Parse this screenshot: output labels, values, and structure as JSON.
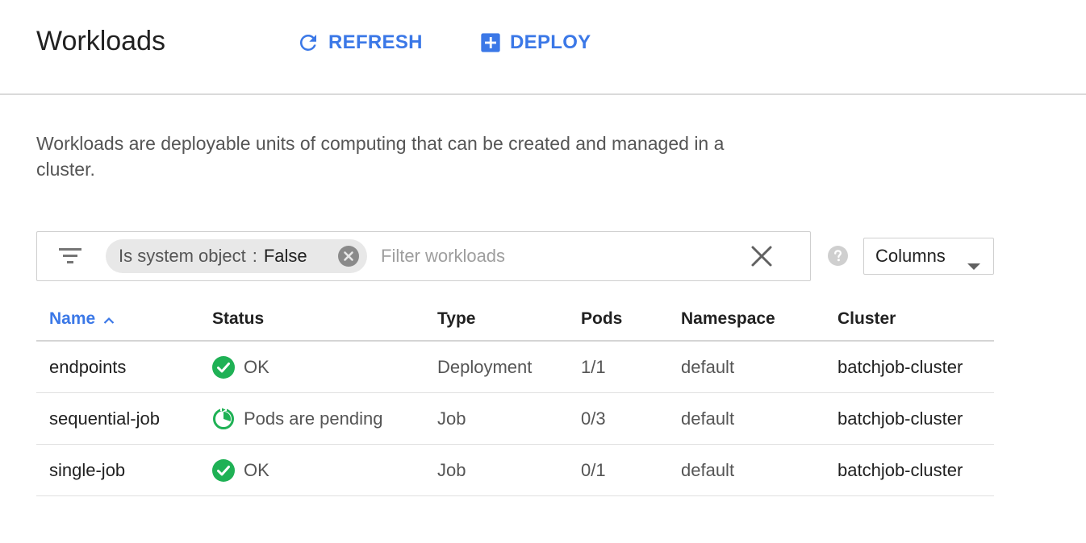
{
  "header": {
    "title": "Workloads",
    "refresh_label": "REFRESH",
    "deploy_label": "DEPLOY"
  },
  "description": "Workloads are deployable units of computing that can be created and managed in a cluster.",
  "filter": {
    "chip_key": "Is system object",
    "chip_sep": ":",
    "chip_value": "False",
    "placeholder": "Filter workloads"
  },
  "columns_button": "Columns",
  "table": {
    "headers": {
      "name": "Name",
      "status": "Status",
      "type": "Type",
      "pods": "Pods",
      "namespace": "Namespace",
      "cluster": "Cluster"
    },
    "sort": {
      "column": "name",
      "direction": "ascending"
    },
    "rows": [
      {
        "name": "endpoints",
        "status": "OK",
        "status_icon": "check-circle-icon",
        "type": "Deployment",
        "pods": "1/1",
        "namespace": "default",
        "cluster": "batchjob-cluster"
      },
      {
        "name": "sequential-job",
        "status": "Pods are pending",
        "status_icon": "pending-circle-icon",
        "type": "Job",
        "pods": "0/3",
        "namespace": "default",
        "cluster": "batchjob-cluster"
      },
      {
        "name": "single-job",
        "status": "OK",
        "status_icon": "check-circle-icon",
        "type": "Job",
        "pods": "0/1",
        "namespace": "default",
        "cluster": "batchjob-cluster"
      }
    ]
  },
  "colors": {
    "accent": "#3b78e7",
    "ok": "#1fb155",
    "text": "#212121",
    "muted": "#555555"
  }
}
